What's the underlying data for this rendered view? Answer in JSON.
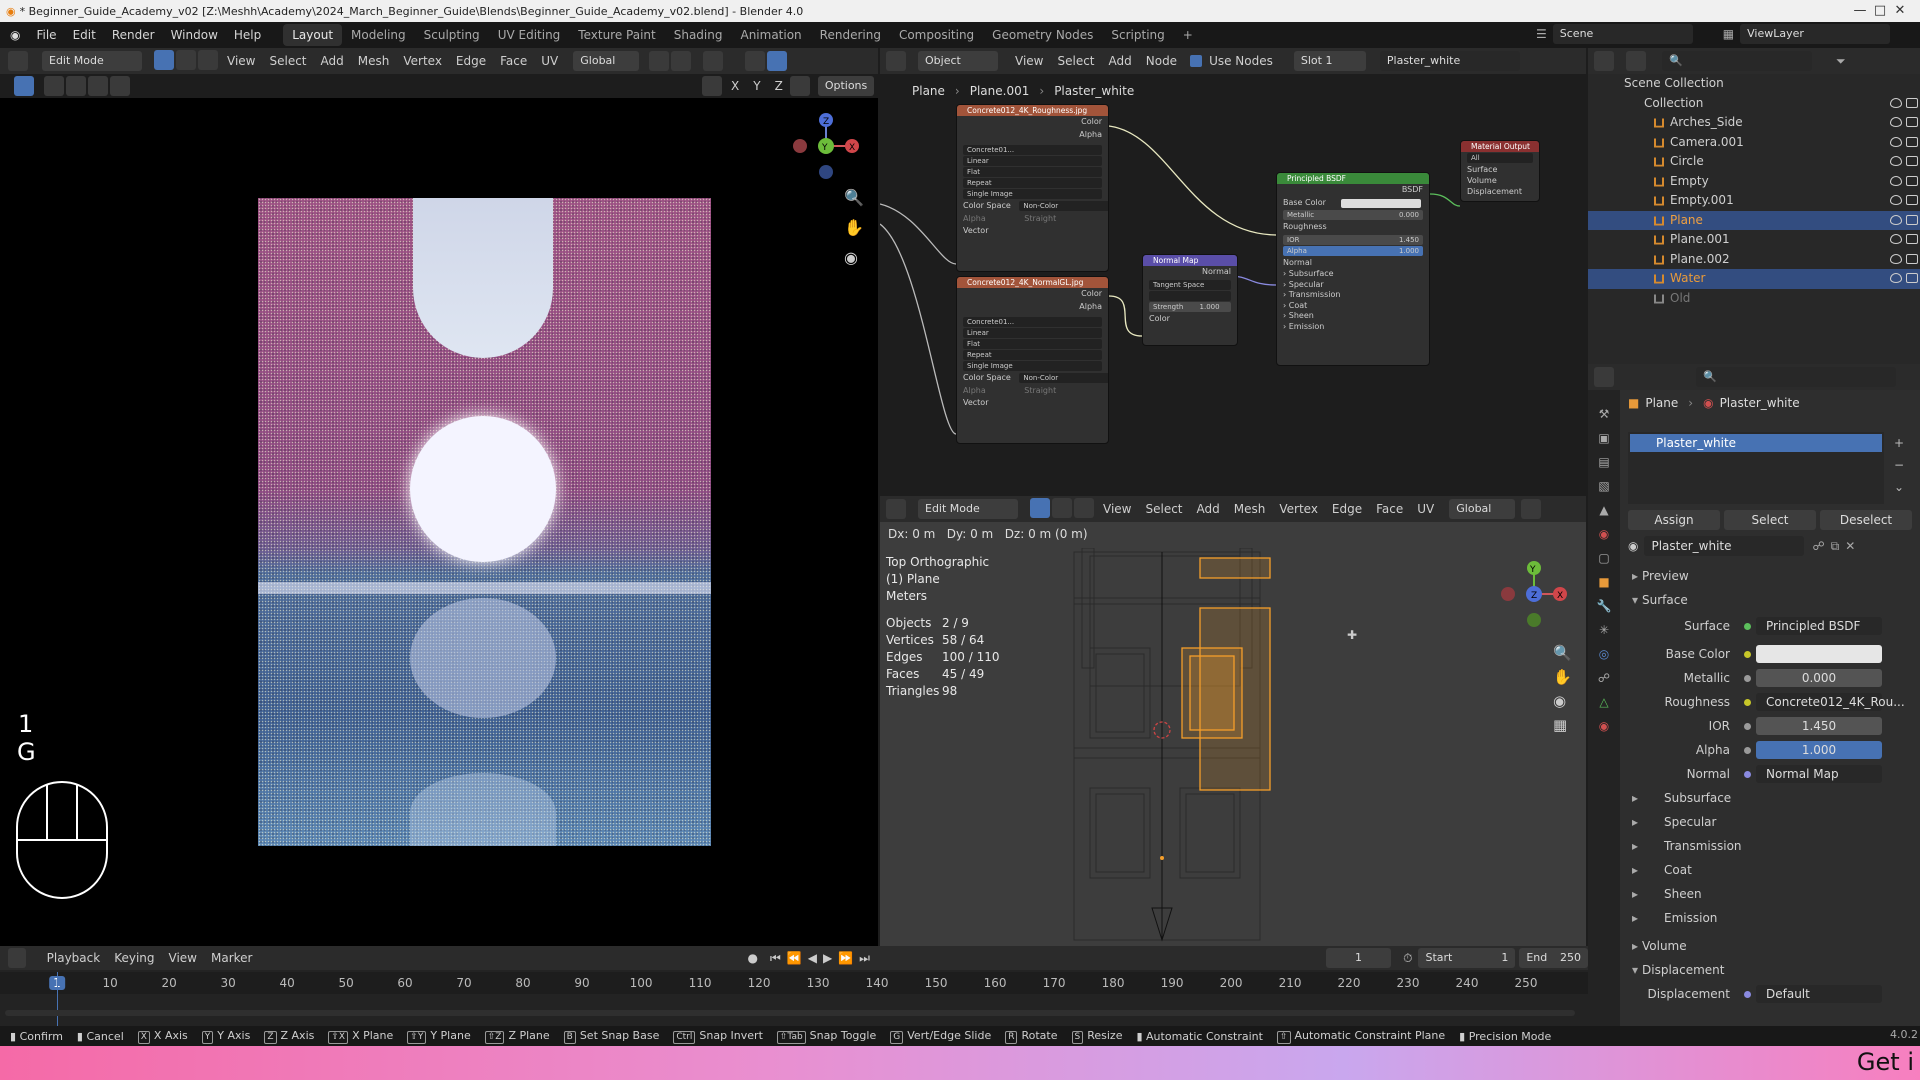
{
  "window": {
    "title": "* Beginner_Guide_Academy_v02 [Z:\\Meshh\\Academy\\2024_March_Beginner_Guide\\Blends\\Beginner_Guide_Academy_v02.blend] - Blender 4.0"
  },
  "menu": [
    "File",
    "Edit",
    "Render",
    "Window",
    "Help"
  ],
  "workspaces": [
    "Layout",
    "Modeling",
    "Sculpting",
    "UV Editing",
    "Texture Paint",
    "Shading",
    "Animation",
    "Rendering",
    "Compositing",
    "Geometry Nodes",
    "Scripting"
  ],
  "scene": {
    "name": "Scene",
    "view_layer": "ViewLayer"
  },
  "vp1": {
    "mode": "Edit Mode",
    "menus": [
      "View",
      "Select",
      "Add",
      "Mesh",
      "Vertex",
      "Edge",
      "Face",
      "UV"
    ],
    "orientation": "Global",
    "options": "Options",
    "axes": [
      "X",
      "Y",
      "Z"
    ],
    "overlay_num": "1",
    "overlay_key": "G"
  },
  "node_editor": {
    "object_mode": "Object",
    "menus": [
      "View",
      "Select",
      "Add",
      "Node"
    ],
    "use_nodes": "Use Nodes",
    "slot": "Slot 1",
    "material": "Plaster_white",
    "breadcrumb": [
      "Plane",
      "Plane.001",
      "Plaster_white"
    ],
    "tex1": {
      "title": "Concrete012_4K_Roughness.jpg",
      "out": [
        "Color",
        "Alpha"
      ],
      "img": "Concrete01...",
      "count": "2",
      "opts": [
        "Linear",
        "Flat",
        "Repeat",
        "Single Image"
      ],
      "cs_label": "Color Space",
      "cs_val": "Non-Color",
      "alpha_label": "Alpha",
      "alpha_val": "Straight",
      "vector": "Vector"
    },
    "tex2": {
      "title": "Concrete012_4K_NormalGL.jpg",
      "out": [
        "Color",
        "Alpha"
      ],
      "img": "Concrete01...",
      "count": "2",
      "opts": [
        "Linear",
        "Flat",
        "Repeat",
        "Single Image"
      ],
      "cs_label": "Color Space",
      "cs_val": "Non-Color",
      "alpha_label": "Alpha",
      "alpha_val": "Straight",
      "vector": "Vector"
    },
    "normalmap": {
      "title": "Normal Map",
      "out": "Normal",
      "space": "Tangent Space",
      "strength_label": "Strength",
      "strength": "1.000",
      "color": "Color"
    },
    "bsdf": {
      "title": "Principled BSDF",
      "out": "BSDF",
      "base_color": "Base Color",
      "metallic": "Metallic",
      "metallic_val": "0.000",
      "roughness": "Roughness",
      "ior": "IOR",
      "ior_val": "1.450",
      "alpha": "Alpha",
      "alpha_val": "1.000",
      "normal": "Normal",
      "sections": [
        "Subsurface",
        "Specular",
        "Transmission",
        "Coat",
        "Sheen",
        "Emission"
      ]
    },
    "output": {
      "title": "Material Output",
      "target": "All",
      "inputs": [
        "Surface",
        "Volume",
        "Displacement"
      ]
    }
  },
  "vp2": {
    "mode": "Edit Mode",
    "menus": [
      "View",
      "Select",
      "Add",
      "Mesh",
      "Vertex",
      "Edge",
      "Face",
      "UV"
    ],
    "orientation": "Global",
    "delta": "Dx: 0 m   Dy: 0 m   Dz: 0 m (0 m)",
    "view_name": "Top Orthographic",
    "object": "(1) Plane",
    "units": "Meters",
    "stats": [
      {
        "k": "Objects",
        "v": "2 / 9"
      },
      {
        "k": "Vertices",
        "v": "58 / 64"
      },
      {
        "k": "Edges",
        "v": "100 / 110"
      },
      {
        "k": "Faces",
        "v": "45 / 49"
      },
      {
        "k": "Triangles",
        "v": "98"
      }
    ]
  },
  "outliner": {
    "root": "Scene Collection",
    "collection": "Collection",
    "items": [
      {
        "name": "Arches_Side",
        "sel": false
      },
      {
        "name": "Camera.001",
        "sel": false
      },
      {
        "name": "Circle",
        "sel": false
      },
      {
        "name": "Empty",
        "sel": false
      },
      {
        "name": "Empty.001",
        "sel": false
      },
      {
        "name": "Plane",
        "sel": true
      },
      {
        "name": "Plane.001",
        "sel": false
      },
      {
        "name": "Plane.002",
        "sel": false
      },
      {
        "name": "Water",
        "sel": true
      },
      {
        "name": "Old",
        "sel": false
      }
    ]
  },
  "properties": {
    "breadcrumb": [
      "Plane",
      "Plaster_white"
    ],
    "slot": "Plaster_white",
    "assign": "Assign",
    "select": "Select",
    "deselect": "Deselect",
    "material": "Plaster_white",
    "preview": "Preview",
    "surface_section": "Surface",
    "surface_label": "Surface",
    "surface_val": "Principled BSDF",
    "rows": [
      {
        "k": "Base Color",
        "v": "",
        "type": "white"
      },
      {
        "k": "Metallic",
        "v": "0.000",
        "type": "num"
      },
      {
        "k": "Roughness",
        "v": "Concrete012_4K_Rou...",
        "type": "link"
      },
      {
        "k": "IOR",
        "v": "1.450",
        "type": "num"
      },
      {
        "k": "Alpha",
        "v": "1.000",
        "type": "blue"
      },
      {
        "k": "Normal",
        "v": "Normal Map",
        "type": "link"
      }
    ],
    "subsections": [
      "Subsurface",
      "Specular",
      "Transmission",
      "Coat",
      "Sheen",
      "Emission"
    ],
    "volume": "Volume",
    "displacement_section": "Displacement",
    "displacement_label": "Displacement",
    "displacement_val": "Default",
    "version": "4.0.2"
  },
  "timeline": {
    "menus": [
      "Playback",
      "Keying",
      "View",
      "Marker"
    ],
    "current": "1",
    "start_label": "Start",
    "start": "1",
    "end_label": "End",
    "end": "250",
    "ticks": [
      "1",
      "10",
      "20",
      "30",
      "40",
      "50",
      "60",
      "70",
      "80",
      "90",
      "100",
      "110",
      "120",
      "130",
      "140",
      "150",
      "160",
      "170",
      "180",
      "190",
      "200",
      "210",
      "220",
      "230",
      "240",
      "250"
    ]
  },
  "status": [
    {
      "key": "",
      "t": "Confirm"
    },
    {
      "key": "",
      "t": "Cancel"
    },
    {
      "key": "X",
      "t": "X Axis"
    },
    {
      "key": "Y",
      "t": "Y Axis"
    },
    {
      "key": "Z",
      "t": "Z Axis"
    },
    {
      "key": "⇧X",
      "t": "X Plane"
    },
    {
      "key": "⇧Y",
      "t": "Y Plane"
    },
    {
      "key": "⇧Z",
      "t": "Z Plane"
    },
    {
      "key": "B",
      "t": "Set Snap Base"
    },
    {
      "key": "Ctrl",
      "t": "Snap Invert"
    },
    {
      "key": "⇧Tab",
      "t": "Snap Toggle"
    },
    {
      "key": "G",
      "t": "Vert/Edge Slide"
    },
    {
      "key": "R",
      "t": "Rotate"
    },
    {
      "key": "S",
      "t": "Resize"
    },
    {
      "key": "",
      "t": "Automatic Constraint"
    },
    {
      "key": "⇧",
      "t": "Automatic Constraint Plane"
    },
    {
      "key": "",
      "t": "Precision Mode"
    }
  ],
  "banner": "Get i"
}
